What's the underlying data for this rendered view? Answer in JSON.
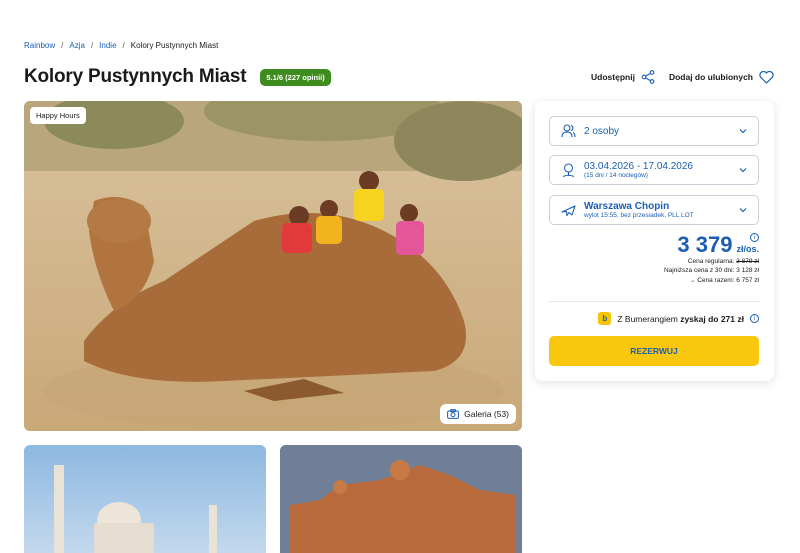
{
  "breadcrumb": {
    "items": [
      "Rainbow",
      "Azja",
      "Indie"
    ],
    "current": "Kolory Pustynnych Miast",
    "separator": "/"
  },
  "header": {
    "title": "Kolory Pustynnych Miast",
    "rating": "5.1/6 (227 opinii)",
    "share_label": "Udostępnij",
    "favorite_label": "Dodaj do ulubionych"
  },
  "hero": {
    "tag": "Happy Hours",
    "gallery_label": "Galeria (53)"
  },
  "booking": {
    "persons": "2 osoby",
    "dates": "03.04.2026 - 17.04.2026",
    "dates_sub": "(15 dni / 14 noclegów)",
    "departure": "Warszawa Chopin",
    "departure_sub": "wylot 15:55, bez przesiadek, PLL LOT",
    "price": "3 379",
    "price_unit": "zł/os.",
    "regular_label": "Cena regularna:",
    "regular_value": "3 879 zł",
    "lowest_30": "Najniższa cena z 30 dni: 3 128 zł",
    "total": "Cena razem: 6 757 zł",
    "bumerang_prefix": "Z Bumerangiem",
    "bumerang_bold": "zyskaj do 271 zł",
    "reserve_label": "REZERWUJ"
  },
  "colors": {
    "primary_blue": "#1a5fb4",
    "rating_green": "#3f8c1e",
    "reserve_yellow": "#f9c80e"
  }
}
